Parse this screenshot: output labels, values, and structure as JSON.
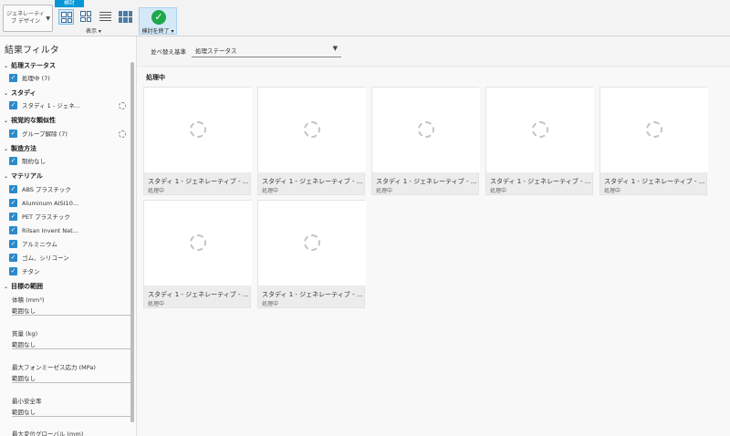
{
  "toolbar": {
    "workspace_label": "ジェネレーティブ デザイン",
    "group_title": "検討",
    "display_label": "表示 ▾",
    "finish_label": "検討を終了 ▾"
  },
  "sidebar": {
    "title": "結果フィルタ",
    "sections": {
      "status": "処理ステータス",
      "study": "スタディ",
      "visual": "視覚的な類似性",
      "manufacturing": "製造方法",
      "material": "マテリアル",
      "target": "目標の範囲"
    },
    "items": {
      "processing": "処理中 (7)",
      "study1": "スタディ 1 - ジェネ...",
      "group_clear": "グループ解除 (7)",
      "unrestricted": "制約なし",
      "abs": "ABS プラスチック",
      "aluminum": "Aluminum AISI10...",
      "pet": "PET プラスチック",
      "rilsan": "Rilsan Invent Nat...",
      "aluminium_jp": "アルミニウム",
      "rubber": "ゴム、シリコーン",
      "titanium": "チタン"
    },
    "ranges": {
      "volume_label": "体積 (mm³)",
      "volume_value": "範囲なし",
      "mass_label": "質量 (kg)",
      "mass_value": "範囲なし",
      "stress_label": "最大フォンミーゼス応力 (MPa)",
      "stress_value": "範囲なし",
      "safety_label": "最小安全率",
      "safety_value": "範囲なし",
      "disp_label": "最大変位グローバル (mm)"
    }
  },
  "main": {
    "sort_label": "並べ替え基準",
    "sort_value": "処理ステータス",
    "group_title": "処理中",
    "cards": [
      {
        "title": "スタディ 1 - ジェネレーティブ - ...",
        "status": "処理中"
      },
      {
        "title": "スタディ 1 - ジェネレーティブ - ...",
        "status": "処理中"
      },
      {
        "title": "スタディ 1 - ジェネレーティブ - ...",
        "status": "処理中"
      },
      {
        "title": "スタディ 1 - ジェネレーティブ - ...",
        "status": "処理中"
      },
      {
        "title": "スタディ 1 - ジェネレーティブ - ...",
        "status": "処理中"
      },
      {
        "title": "スタディ 1 - ジェネレーティブ - ...",
        "status": "処理中"
      },
      {
        "title": "スタディ 1 - ジェネレーティブ - ...",
        "status": "処理中"
      }
    ]
  }
}
